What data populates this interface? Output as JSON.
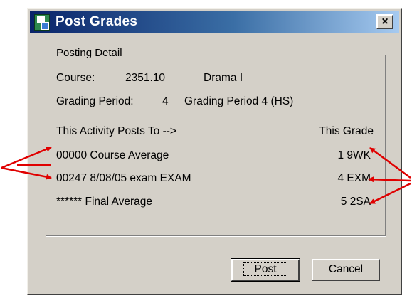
{
  "dialog": {
    "title": "Post Grades",
    "close_glyph": "×",
    "groupbox_label": "Posting Detail",
    "course": {
      "label": "Course:",
      "number": "2351.10",
      "name": "Drama I"
    },
    "grading_period": {
      "label": "Grading Period:",
      "number": "4",
      "name": "Grading Period 4 (HS)"
    },
    "headers": {
      "activity": "This Activity Posts To -->",
      "grade": "This Grade"
    },
    "rows": [
      {
        "activity": "00000 Course Average",
        "grade": "1 9WK"
      },
      {
        "activity": "00247  8/08/05 exam EXAM",
        "grade": "4 EXM"
      },
      {
        "activity": "****** Final Average",
        "grade": "5 2SA"
      }
    ],
    "buttons": {
      "post": "Post",
      "cancel": "Cancel"
    }
  },
  "icons": [
    "app-icon",
    "close-icon"
  ],
  "colors": {
    "dialog_bg": "#d4d0c8",
    "title_gradient_start": "#0a246a",
    "title_gradient_end": "#a6caf0",
    "annotation_arrow": "#e00000"
  }
}
